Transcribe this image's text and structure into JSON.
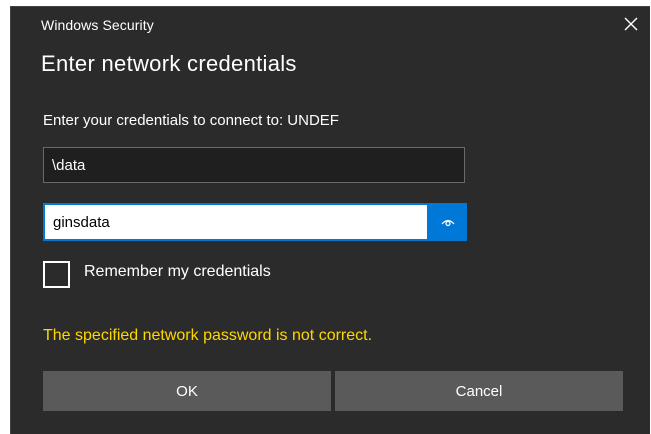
{
  "window": {
    "title": "Windows Security",
    "close_icon": "close-icon"
  },
  "dialog": {
    "heading": "Enter network credentials",
    "prompt": "Enter your credentials to connect to: UNDEF"
  },
  "fields": {
    "username_value": "\\data",
    "password_value": "ginsdata",
    "reveal_icon": "eye-icon"
  },
  "remember": {
    "label": "Remember my credentials",
    "checked": false
  },
  "error": {
    "message": "The specified network password is not correct."
  },
  "buttons": {
    "ok_label": "OK",
    "cancel_label": "Cancel"
  },
  "colors": {
    "background": "#2b2b2b",
    "accent": "#0078d7",
    "error": "#ffd700",
    "button": "#5a5a5a"
  }
}
